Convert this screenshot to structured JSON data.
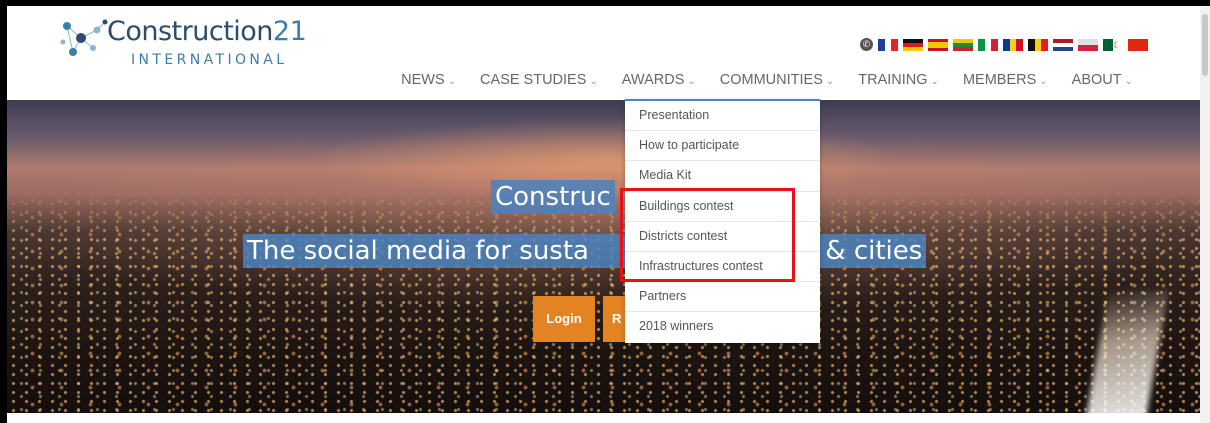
{
  "logo": {
    "name_main": "Construction",
    "name_num": "21",
    "subtitle": "INTERNATIONAL"
  },
  "languages": {
    "globe_icon": "globe-icon",
    "flags": [
      "fr",
      "de",
      "es",
      "lt",
      "it",
      "ro",
      "be",
      "nl",
      "pl",
      "dz",
      "cn"
    ]
  },
  "nav": {
    "items": [
      {
        "label": "NEWS"
      },
      {
        "label": "CASE STUDIES"
      },
      {
        "label": "AWARDS"
      },
      {
        "label": "COMMUNITIES"
      },
      {
        "label": "TRAINING"
      },
      {
        "label": "MEMBERS"
      },
      {
        "label": "ABOUT"
      }
    ],
    "chevron": "⌄"
  },
  "hero": {
    "title": "Construc",
    "subtitle": "The social media for susta",
    "subtitle_end": "gs & cities",
    "login_label": "Login",
    "register_label": "R"
  },
  "awards_menu": {
    "items": [
      {
        "label": "Presentation"
      },
      {
        "label": "How to participate"
      },
      {
        "label": "Media Kit"
      },
      {
        "label": "Buildings contest"
      },
      {
        "label": "Districts contest"
      },
      {
        "label": "Infrastructures contest"
      },
      {
        "label": "Partners"
      },
      {
        "label": "2018 winners"
      }
    ]
  },
  "colors": {
    "accent": "#4a86c4",
    "button": "#e38322",
    "highlight": "#e8101a",
    "logo_dark": "#2a4d6e",
    "logo_light": "#3a7fa8"
  }
}
